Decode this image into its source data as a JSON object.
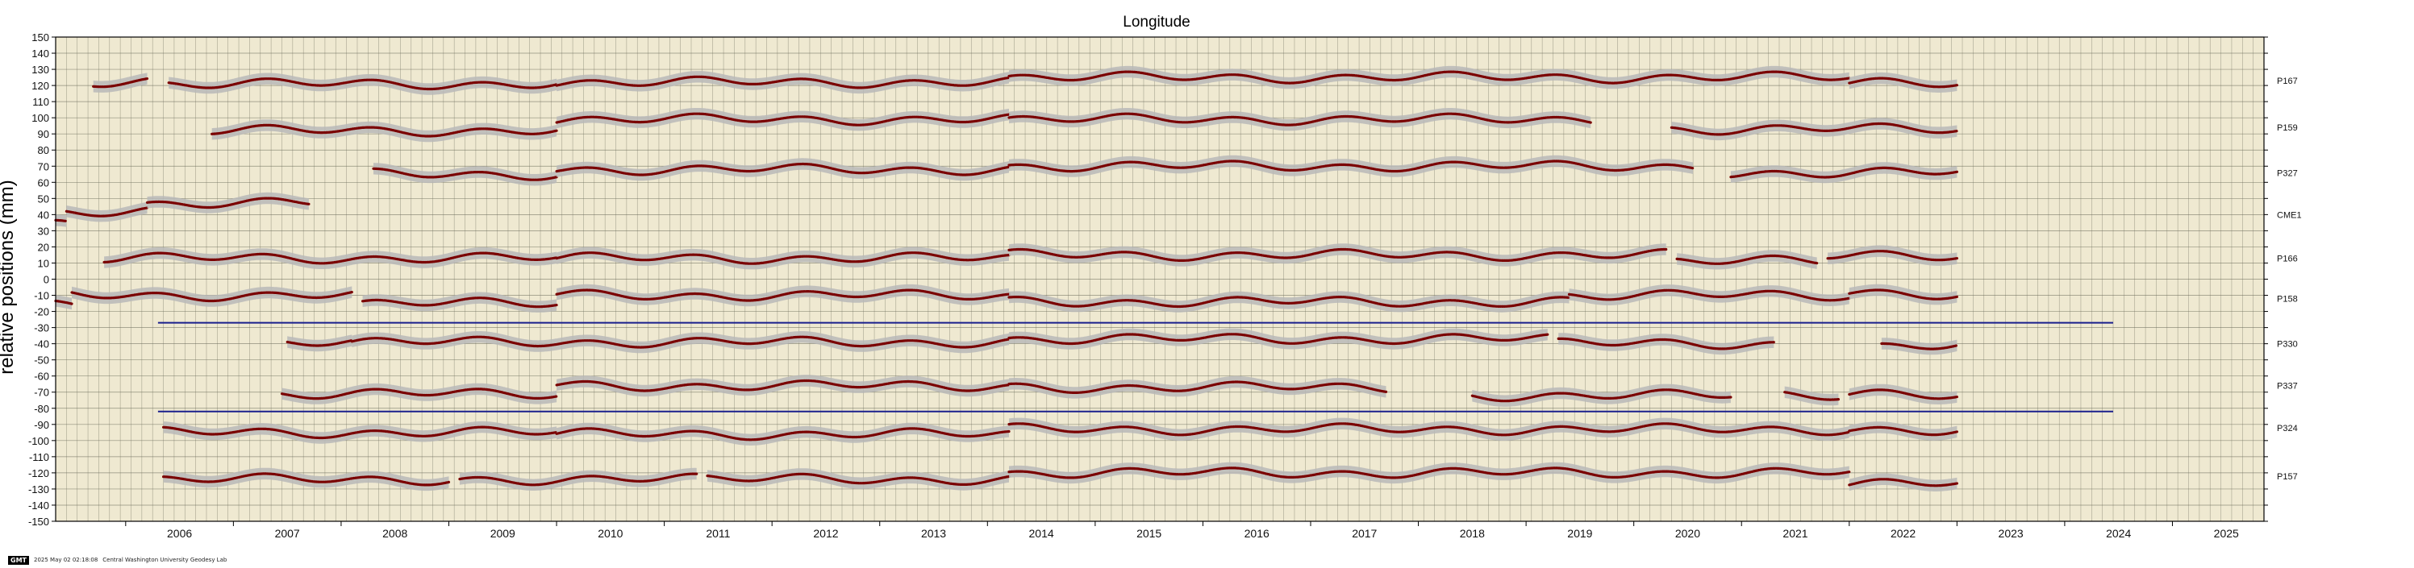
{
  "chart_data": {
    "type": "scatter",
    "title": "Longitude",
    "ylabel": "relative positions (mm)",
    "xlabel": "",
    "xlim": [
      2005.35,
      2025.85
    ],
    "ylim": [
      -150,
      150
    ],
    "y_ticks": [
      150,
      140,
      130,
      120,
      110,
      100,
      90,
      80,
      70,
      60,
      50,
      40,
      30,
      20,
      10,
      0,
      -10,
      -20,
      -30,
      -40,
      -50,
      -60,
      -70,
      -80,
      -90,
      -100,
      -110,
      -120,
      -130,
      -140,
      -150
    ],
    "x_tick_labels": [
      "2006",
      "2007",
      "2008",
      "2009",
      "2010",
      "2011",
      "2012",
      "2013",
      "2014",
      "2015",
      "2016",
      "2017",
      "2018",
      "2019",
      "2020",
      "2021",
      "2022",
      "2023",
      "2024",
      "2025"
    ],
    "grid": true,
    "colors": {
      "background": "#efe9d1",
      "grid": "#6b6b5a",
      "points": "#7a0000",
      "error_band": "#b8b8b8",
      "reference_lines": "#1a1f8c"
    },
    "reference_lines": [
      {
        "y": -27,
        "x_start": 2006.3,
        "x_end": 2024.45
      },
      {
        "y": -82,
        "x_start": 2006.3,
        "x_end": 2024.45
      }
    ],
    "series": [
      {
        "name": "P167",
        "label_y": 123,
        "segments": [
          {
            "start": 2005.7,
            "end": 2006.2,
            "level": 122
          },
          {
            "start": 2006.4,
            "end": 2010.0,
            "level": 121
          },
          {
            "start": 2010.0,
            "end": 2014.2,
            "level": 122
          },
          {
            "start": 2014.2,
            "end": 2022.0,
            "level": 125
          },
          {
            "start": 2022.0,
            "end": 2023.0,
            "level": 121
          }
        ]
      },
      {
        "name": "P159",
        "label_y": 94,
        "segments": [
          {
            "start": 2006.8,
            "end": 2010.0,
            "level": 92
          },
          {
            "start": 2010.0,
            "end": 2014.2,
            "level": 99
          },
          {
            "start": 2014.2,
            "end": 2019.6,
            "level": 99
          },
          {
            "start": 2020.35,
            "end": 2023.0,
            "level": 93
          }
        ]
      },
      {
        "name": "P327",
        "label_y": 66,
        "segments": [
          {
            "start": 2008.3,
            "end": 2010.0,
            "level": 65
          },
          {
            "start": 2010.0,
            "end": 2014.2,
            "level": 68
          },
          {
            "start": 2014.2,
            "end": 2020.55,
            "level": 70
          },
          {
            "start": 2020.9,
            "end": 2023.0,
            "level": 66
          }
        ]
      },
      {
        "name": "CME1",
        "label_y": 40,
        "segments": [
          {
            "start": 2005.35,
            "end": 2005.45,
            "level": 34
          },
          {
            "start": 2005.45,
            "end": 2006.2,
            "level": 42
          },
          {
            "start": 2006.2,
            "end": 2007.7,
            "level": 47
          }
        ]
      },
      {
        "name": "P166",
        "label_y": 13,
        "segments": [
          {
            "start": 2005.8,
            "end": 2010.0,
            "level": 13
          },
          {
            "start": 2010.0,
            "end": 2014.2,
            "level": 13
          },
          {
            "start": 2014.2,
            "end": 2020.3,
            "level": 15
          },
          {
            "start": 2020.4,
            "end": 2021.7,
            "level": 11
          },
          {
            "start": 2021.8,
            "end": 2023.0,
            "level": 14
          }
        ]
      },
      {
        "name": "P158",
        "label_y": -12,
        "segments": [
          {
            "start": 2005.35,
            "end": 2005.5,
            "level": -15
          },
          {
            "start": 2005.5,
            "end": 2008.1,
            "level": -10
          },
          {
            "start": 2008.2,
            "end": 2010.0,
            "level": -15
          },
          {
            "start": 2010.0,
            "end": 2014.2,
            "level": -10
          },
          {
            "start": 2014.2,
            "end": 2019.4,
            "level": -14
          },
          {
            "start": 2019.4,
            "end": 2022.0,
            "level": -10
          },
          {
            "start": 2022.0,
            "end": 2023.0,
            "level": -9
          }
        ]
      },
      {
        "name": "P330",
        "label_y": -40,
        "segments": [
          {
            "start": 2007.5,
            "end": 2008.1,
            "level": -40
          },
          {
            "start": 2008.1,
            "end": 2014.2,
            "level": -39
          },
          {
            "start": 2014.2,
            "end": 2019.2,
            "level": -37
          },
          {
            "start": 2019.3,
            "end": 2021.3,
            "level": -40
          },
          {
            "start": 2022.3,
            "end": 2023.0,
            "level": -41
          }
        ]
      },
      {
        "name": "P337",
        "label_y": -66,
        "segments": [
          {
            "start": 2007.45,
            "end": 2010.0,
            "level": -71
          },
          {
            "start": 2010.0,
            "end": 2014.2,
            "level": -66
          },
          {
            "start": 2014.2,
            "end": 2017.7,
            "level": -67
          },
          {
            "start": 2018.5,
            "end": 2020.9,
            "level": -72
          },
          {
            "start": 2021.4,
            "end": 2021.9,
            "level": -73
          },
          {
            "start": 2022.0,
            "end": 2023.0,
            "level": -72
          }
        ]
      },
      {
        "name": "P324",
        "label_y": -92,
        "segments": [
          {
            "start": 2006.35,
            "end": 2010.0,
            "level": -95
          },
          {
            "start": 2010.0,
            "end": 2014.2,
            "level": -96
          },
          {
            "start": 2014.2,
            "end": 2022.0,
            "level": -93
          },
          {
            "start": 2022.0,
            "end": 2023.0,
            "level": -93
          }
        ]
      },
      {
        "name": "P157",
        "label_y": -122,
        "segments": [
          {
            "start": 2006.35,
            "end": 2009.0,
            "level": -124
          },
          {
            "start": 2009.1,
            "end": 2011.3,
            "level": -124
          },
          {
            "start": 2011.4,
            "end": 2014.2,
            "level": -124
          },
          {
            "start": 2014.2,
            "end": 2022.0,
            "level": -120
          },
          {
            "start": 2022.0,
            "end": 2023.0,
            "level": -127
          }
        ]
      }
    ]
  },
  "footer": {
    "badge": "GMT",
    "timestamp": "2025 May 02 02:18:08",
    "credit": "Central Washington University Geodesy Lab"
  }
}
